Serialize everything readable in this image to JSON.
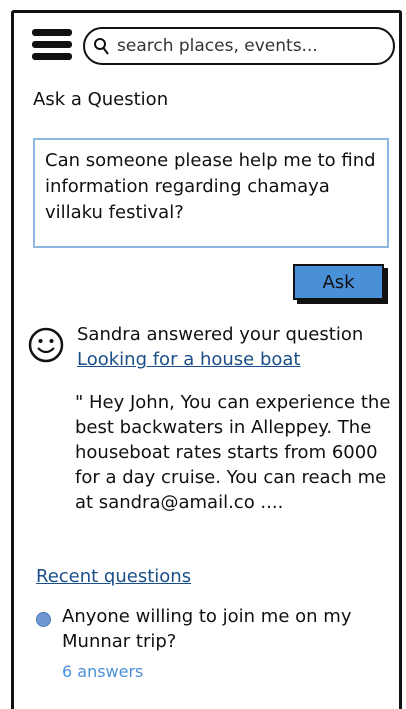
{
  "search": {
    "placeholder": "search places, events..."
  },
  "ask": {
    "title": "Ask a Question",
    "question_text": "Can someone please help me to find information regarding chamaya villaku festival?",
    "button_label": "Ask"
  },
  "answer": {
    "header": "Sandra answered your question",
    "question_link": "Looking for a house boat",
    "body": "\" Hey John, You can experience the best backwaters in Alleppey. The houseboat rates starts from 6000 for a day cruise. You can reach me at sandra@amail.co ...."
  },
  "recent": {
    "title": "Recent questions",
    "items": [
      {
        "question": "Anyone willing to join me on my Munnar trip?",
        "answers": "6 answers"
      }
    ]
  },
  "colors": {
    "accent": "#4a90d9",
    "link": "#1b4f8a",
    "input_border": "#8fb7e3"
  },
  "icons": {
    "menu": "hamburger-menu-icon",
    "search": "search-icon",
    "avatar": "smiley-icon",
    "bullet": "bullet-dot-icon"
  }
}
